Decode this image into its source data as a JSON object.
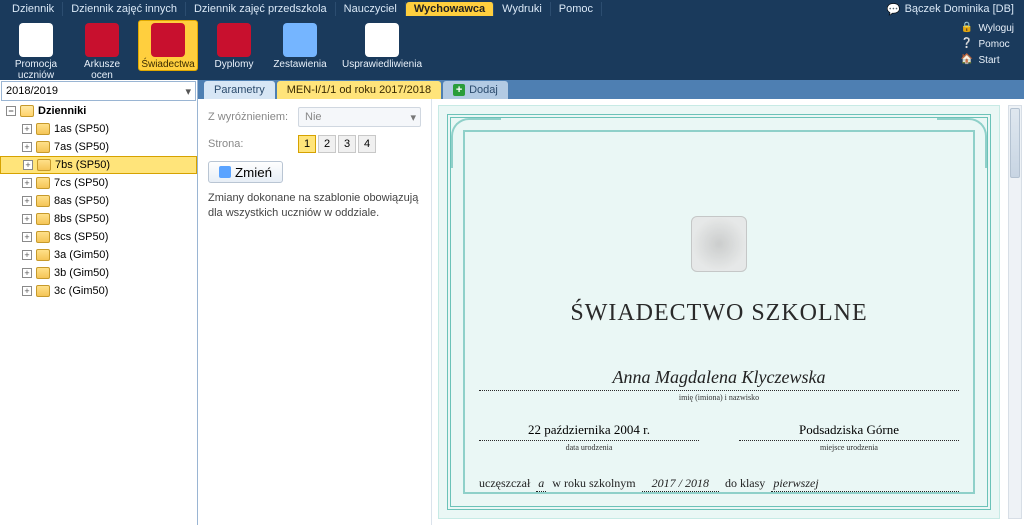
{
  "menubar": {
    "items": [
      "Dziennik",
      "Dziennik zajęć innych",
      "Dziennik zajęć przedszkola",
      "Nauczyciel",
      "Wychowawca",
      "Wydruki",
      "Pomoc"
    ],
    "active_index": 4,
    "user": "Bączek Dominika [DB]"
  },
  "ribbon": {
    "buttons": [
      {
        "label": "Promocja uczniów"
      },
      {
        "label": "Arkusze ocen"
      },
      {
        "label": "Świadectwa"
      },
      {
        "label": "Dyplomy"
      },
      {
        "label": "Zestawienia"
      },
      {
        "label": "Usprawiedliwienia"
      }
    ],
    "active_index": 2,
    "right": {
      "logout": "Wyloguj",
      "help": "Pomoc",
      "start": "Start"
    }
  },
  "year": "2018/2019",
  "tree": {
    "root": "Dzienniki",
    "items": [
      "1as (SP50)",
      "7as (SP50)",
      "7bs (SP50)",
      "7cs (SP50)",
      "8as (SP50)",
      "8bs (SP50)",
      "8cs (SP50)",
      "3a (Gim50)",
      "3b (Gim50)",
      "3c (Gim50)"
    ],
    "selected_index": 2
  },
  "tabs": {
    "items": [
      "Parametry",
      "MEN-I/1/1 od roku 2017/2018"
    ],
    "add_label": "Dodaj",
    "selected_index": 1
  },
  "params": {
    "highlight_label": "Z wyróżnieniem:",
    "highlight_value": "Nie",
    "page_label": "Strona:",
    "pages": [
      "1",
      "2",
      "3",
      "4"
    ],
    "selected_page": 0,
    "change_btn": "Zmień",
    "note": "Zmiany dokonane na szablonie obowiązują dla wszystkich uczniów w oddziale."
  },
  "certificate": {
    "title": "ŚWIADECTWO SZKOLNE",
    "name": "Anna Magdalena Klyczewska",
    "name_sub": "imię (imiona) i nazwisko",
    "dob": "22 października 2004 r.",
    "dob_sub": "data urodzenia",
    "pob": "Podsadziska Górne",
    "pob_sub": "miejsce urodzenia",
    "line_pre": "uczęszczał",
    "line_suffix": "a",
    "line_mid": "w roku szkolnym",
    "year_range": "2017 / 2018",
    "line_after": "do klasy",
    "class": "pierwszej"
  }
}
